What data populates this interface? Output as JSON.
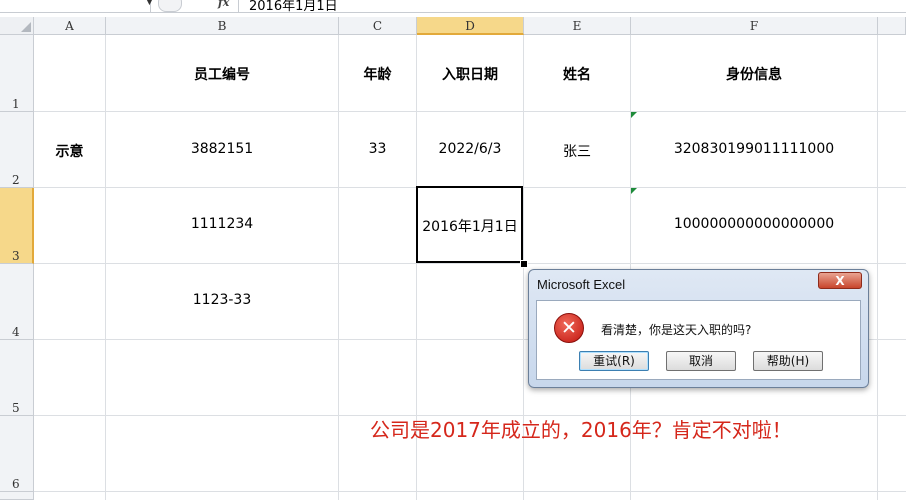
{
  "formula_bar": {
    "formula_value": "2016年1月1日"
  },
  "columns": [
    {
      "letter": "A"
    },
    {
      "letter": "B"
    },
    {
      "letter": "C"
    },
    {
      "letter": "D"
    },
    {
      "letter": "E"
    },
    {
      "letter": "F"
    }
  ],
  "rows": [
    "1",
    "2",
    "3",
    "4",
    "5",
    "6"
  ],
  "cells": {
    "B1": "员工编号",
    "C1": "年龄",
    "D1": "入职日期",
    "E1": "姓名",
    "F1": "身份信息",
    "A2": "示意",
    "B2": "3882151",
    "C2": "33",
    "D2": "2022/6/3",
    "E2": "张三",
    "F2": "320830199011111000",
    "B3": "1111234",
    "D3": "2016年1月1日",
    "F3": "100000000000000000",
    "B4": "1123-33"
  },
  "annotation": "公司是2017年成立的，2016年？肯定不对啦！",
  "dialog": {
    "title": "Microsoft Excel",
    "message": "看清楚，你是这天入职的吗?",
    "close_label": "X",
    "retry_label": "重试(R)",
    "cancel_label": "取消",
    "help_label": "帮助(H)"
  },
  "colors": {
    "annotation": "#d5271b",
    "active_header": "#f6d88a",
    "error_icon": "#c1140e"
  },
  "icons": {
    "fx": "fx-icon",
    "error": "error-icon"
  }
}
